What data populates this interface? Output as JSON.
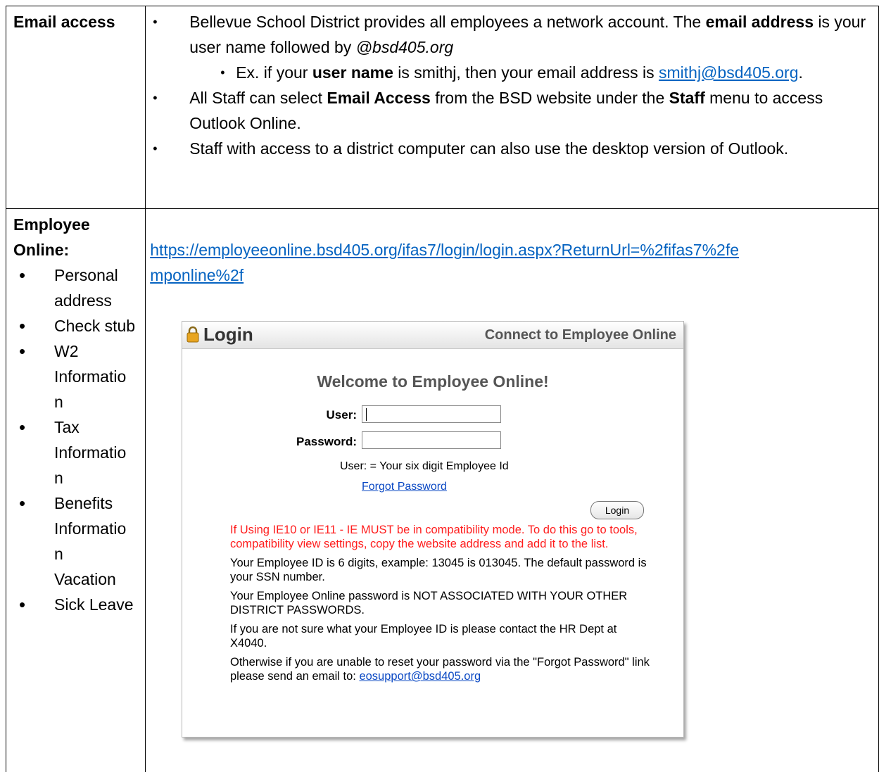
{
  "row1": {
    "label": "Email access",
    "bullet1": {
      "p1": "Bellevue School District provides all employees a network account. The ",
      "b1": "email address",
      "p2": " is your user name followed by ",
      "i1": "@bsd405.org"
    },
    "sub_bullet": {
      "p1": "Ex. if your ",
      "b1": "user name",
      "p2": " is smithj, then your email address is ",
      "link": "smithj@bsd405.org",
      "p3": "."
    },
    "bullet2": {
      "p1": "All Staff can select ",
      "b1": "Email Access",
      "p2": " from the BSD website under the ",
      "b2": "Staff",
      "p3": " menu to access Outlook Online."
    },
    "bullet3": "Staff with access to a district computer can also use the desktop version of Outlook."
  },
  "row2": {
    "label_line1": "Employee",
    "label_line2": "Online:",
    "items": [
      "Personal address",
      "Check stub",
      "W2 Informatio n",
      "Tax Informatio n",
      "Benefits Informatio n",
      "Vacation",
      "Sick Leave"
    ],
    "url_line1": "https://employeeonline.bsd405.org/ifas7/login/login.aspx?ReturnUrl=%2fifas7%2fe",
    "url_line2": "mponline%2f"
  },
  "login": {
    "title": "Login",
    "subtitle": "Connect to Employee Online",
    "welcome": "Welcome to Employee Online!",
    "user_label": "User:",
    "password_label": "Password:",
    "user_hint": "User: = Your six digit Employee Id",
    "forgot": "Forgot Password",
    "button": "Login",
    "warning": "If Using IE10 or IE11 - IE MUST be in compatibility mode. To do this go to tools, compatibility view settings, copy the website address and add it to the list.",
    "p1": "Your Employee ID is 6 digits, example: 13045 is 013045. The default password is your SSN number.",
    "p2": "Your Employee Online password is NOT ASSOCIATED WITH YOUR OTHER DISTRICT PASSWORDS.",
    "p3": "If you are not sure what your Employee ID is please contact the HR Dept at X4040.",
    "p4_text": "Otherwise if you are unable to reset your password via the \"Forgot Password\" link please send an email to: ",
    "p4_email": "eosupport@bsd405.org"
  }
}
